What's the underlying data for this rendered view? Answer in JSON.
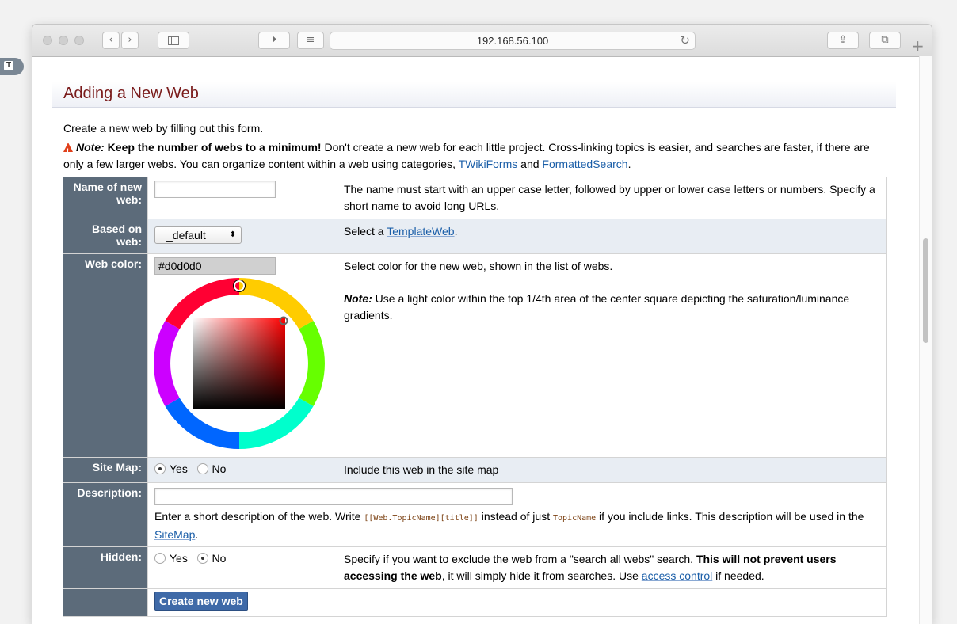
{
  "browser": {
    "url": "192.168.56.100",
    "new_tab_label": "+"
  },
  "page": {
    "title": "Adding a New Web",
    "intro": "Create a new web by filling out this form.",
    "note": {
      "label": "Note:",
      "bold": "Keep the number of webs to a minimum!",
      "text": " Don't create a new web for each little project. Cross-linking topics is easier, and searches are faster, if there are only a few larger webs. You can organize content within a web using categories, ",
      "link1": "TWikiForms",
      "and": " and ",
      "link2": "FormattedSearch",
      "end": "."
    }
  },
  "form": {
    "name": {
      "label": "Name of new web:",
      "value": "",
      "help": "The name must start with an upper case letter, followed by upper or lower case letters or numbers. Specify a short name to avoid long URLs."
    },
    "based_on": {
      "label": "Based on web:",
      "selected": "_default",
      "help_prefix": "Select a ",
      "help_link": "TemplateWeb",
      "help_suffix": "."
    },
    "color": {
      "label": "Web color:",
      "value": "#d0d0d0",
      "help": "Select color for the new web, shown in the list of webs.",
      "note_label": "Note:",
      "note": " Use a light color within the top 1/4th area of the center square depicting the saturation/luminance gradients."
    },
    "sitemap": {
      "label": "Site Map:",
      "yes": "Yes",
      "no": "No",
      "selected": "Yes",
      "help": "Include this web in the site map"
    },
    "description": {
      "label": "Description:",
      "value": "",
      "help_a": "Enter a short description of the web. Write ",
      "code1": "[[Web.TopicName][title]]",
      "help_b": " instead of just ",
      "code2": "TopicName",
      "help_c": " if you include links. This description will be used in the ",
      "link": "SiteMap",
      "help_d": "."
    },
    "hidden": {
      "label": "Hidden:",
      "yes": "Yes",
      "no": "No",
      "selected": "No",
      "help_a": "Specify if you want to exclude the web from a \"search all webs\" search. ",
      "help_bold": "This will not prevent users accessing the web",
      "help_b": ", it will simply hide it from searches. Use ",
      "link": "access control",
      "help_c": " if needed."
    },
    "submit_label": "Create new web"
  },
  "colors": {
    "header_cell": "#5c6b7a",
    "link": "#1a5ea8",
    "title": "#7a1b1b",
    "button": "#3f6aa8"
  }
}
